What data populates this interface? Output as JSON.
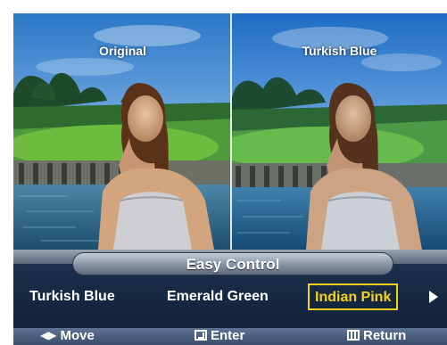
{
  "preview": {
    "left_label": "Original",
    "right_label": "Turkish Blue"
  },
  "menu": {
    "title": "Easy Control",
    "options": [
      "Turkish Blue",
      "Emerald Green",
      "Indian Pink"
    ],
    "selected": "Indian Pink",
    "highlight_color": "#f4d21c"
  },
  "hints": {
    "move": "Move",
    "enter": "Enter",
    "return": "Return"
  },
  "icons": {
    "move": "left-right-arrows-icon",
    "enter": "enter-icon",
    "return": "menu-return-icon",
    "next": "next-arrow-icon"
  }
}
